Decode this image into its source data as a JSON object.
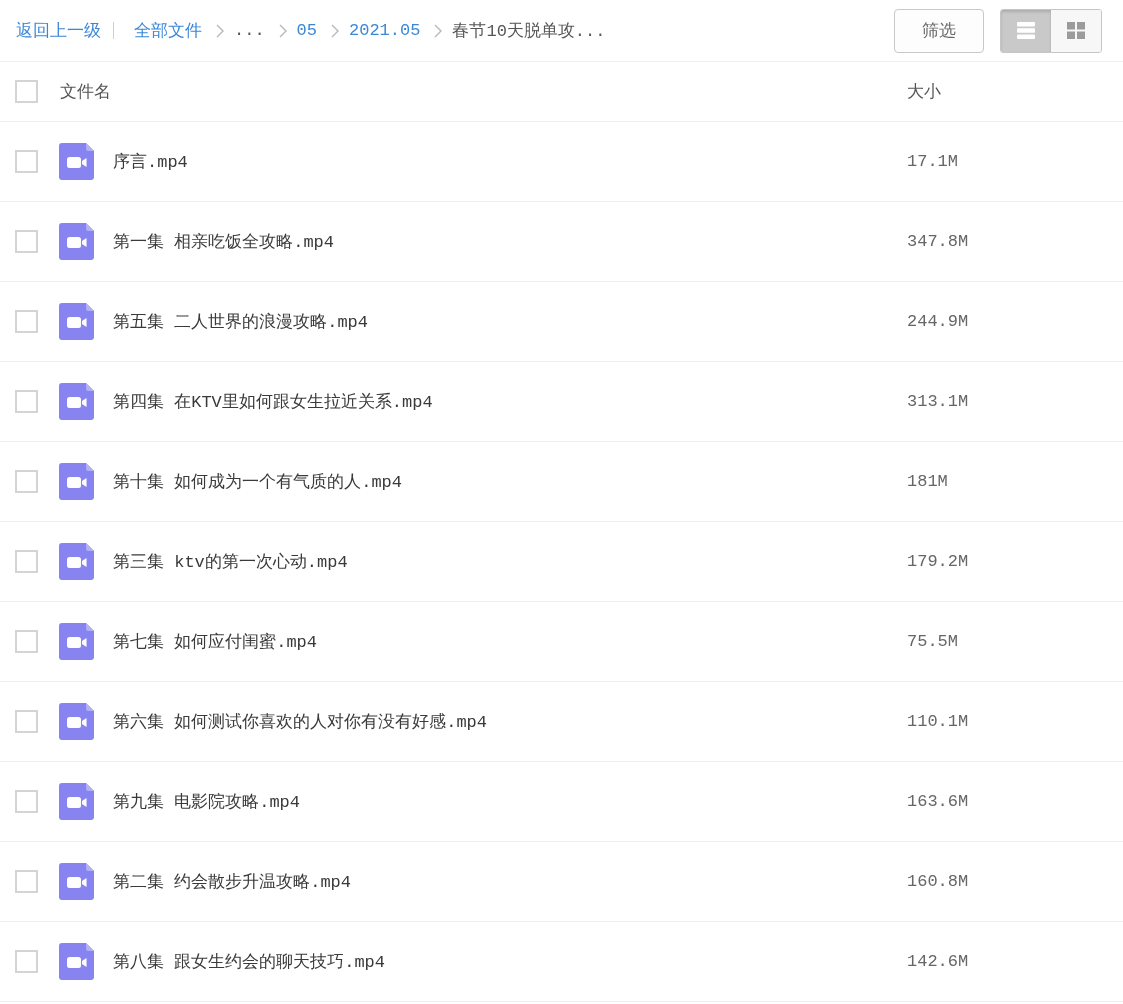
{
  "toolbar": {
    "back_link": "返回上一级",
    "breadcrumb": [
      {
        "kind": "link",
        "label": "全部文件"
      },
      {
        "kind": "text",
        "label": "..."
      },
      {
        "kind": "link",
        "label": "05"
      },
      {
        "kind": "link",
        "label": "2021.05"
      },
      {
        "kind": "text",
        "label": "春节10天脱单攻..."
      }
    ],
    "filter_button": "筛选",
    "view_modes": [
      {
        "kind": "list",
        "selected": true
      },
      {
        "kind": "grid",
        "selected": false
      }
    ]
  },
  "table": {
    "select_all": {
      "checked": false
    },
    "columns": [
      "文件名",
      "大小"
    ],
    "rows": [
      {
        "checked": false,
        "kind": "video",
        "name": "序言.mp4",
        "size": "17.1M"
      },
      {
        "checked": false,
        "kind": "video",
        "name": "第一集 相亲吃饭全攻略.mp4",
        "size": "347.8M"
      },
      {
        "checked": false,
        "kind": "video",
        "name": "第五集 二人世界的浪漫攻略.mp4",
        "size": "244.9M"
      },
      {
        "checked": false,
        "kind": "video",
        "name": "第四集 在KTV里如何跟女生拉近关系.mp4",
        "size": "313.1M"
      },
      {
        "checked": false,
        "kind": "video",
        "name": "第十集 如何成为一个有气质的人.mp4",
        "size": "181M"
      },
      {
        "checked": false,
        "kind": "video",
        "name": "第三集 ktv的第一次心动.mp4",
        "size": "179.2M"
      },
      {
        "checked": false,
        "kind": "video",
        "name": "第七集 如何应付闺蜜.mp4",
        "size": "75.5M"
      },
      {
        "checked": false,
        "kind": "video",
        "name": "第六集 如何测试你喜欢的人对你有没有好感.mp4",
        "size": "110.1M"
      },
      {
        "checked": false,
        "kind": "video",
        "name": "第九集 电影院攻略.mp4",
        "size": "163.6M"
      },
      {
        "checked": false,
        "kind": "video",
        "name": "第二集 约会散步升温攻略.mp4",
        "size": "160.8M"
      },
      {
        "checked": false,
        "kind": "video",
        "name": "第八集 跟女生约会的聊天技巧.mp4",
        "size": "142.6M"
      }
    ]
  }
}
